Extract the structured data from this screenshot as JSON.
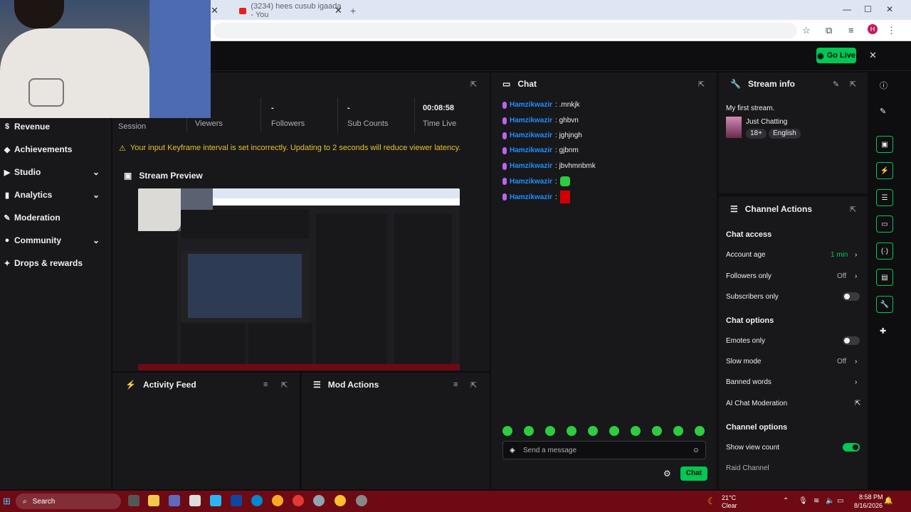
{
  "browser": {
    "tabs": [
      {
        "title": "(3234) hees cusub igaada - You",
        "close": "✕"
      }
    ],
    "new_tab": "+",
    "window_controls": [
      "—",
      "☐",
      "✕"
    ],
    "profile_initial": "H"
  },
  "topbar": {
    "go_live_label": "Go Live",
    "close_icon": "✕"
  },
  "leftnav": {
    "items": [
      {
        "label": "Revenue",
        "icon": "revenue-icon",
        "chevron": false
      },
      {
        "label": "Achievements",
        "icon": "achievements-icon",
        "chevron": false
      },
      {
        "label": "Studio",
        "icon": "studio-icon",
        "chevron": true
      },
      {
        "label": "Analytics",
        "icon": "analytics-icon",
        "chevron": true
      },
      {
        "label": "Moderation",
        "icon": "moderation-icon",
        "chevron": false
      },
      {
        "label": "Community",
        "icon": "community-icon",
        "chevron": true
      },
      {
        "label": "Drops & rewards",
        "icon": "drops-icon",
        "chevron": false
      }
    ]
  },
  "stats": {
    "session_label": "Session",
    "viewers_label": "Viewers",
    "followers_value": "-",
    "followers_label": "Followers",
    "subcounts_value": "-",
    "subcounts_label": "Sub Counts",
    "timelive_value": "00:08:58",
    "timelive_label": "Time Live",
    "warning": "Your input Keyframe interval is set incorrectly. Updating to 2 seconds will reduce viewer latency."
  },
  "preview": {
    "title": "Stream Preview"
  },
  "activity": {
    "title": "Activity Feed"
  },
  "mod": {
    "title": "Mod Actions"
  },
  "chat": {
    "title": "Chat",
    "messages": [
      {
        "user": "Hamzikwazir",
        "text": ": .mnkjk"
      },
      {
        "user": "Hamzikwazir",
        "text": ": ghbvn"
      },
      {
        "user": "Hamzikwazir",
        "text": ": jghjngh"
      },
      {
        "user": "Hamzikwazir",
        "text": ": gjbnm"
      },
      {
        "user": "Hamzikwazir",
        "text": ": jbvhmnbmk"
      },
      {
        "user": "Hamzikwazir",
        "text": ":"
      },
      {
        "user": "Hamzikwazir",
        "text": ":"
      }
    ],
    "input_placeholder": "Send a message",
    "send_label": "Chat"
  },
  "streaminfo": {
    "title": "Stream info",
    "stream_title": "My first stream.",
    "category": "Just Chatting",
    "tags": [
      "18+",
      "English"
    ]
  },
  "channelactions": {
    "title": "Channel Actions",
    "chat_access": "Chat access",
    "account_age": "Account age",
    "account_age_value": "1 min",
    "followers_only": "Followers only",
    "followers_only_value": "Off",
    "subscribers_only": "Subscribers only",
    "chat_options": "Chat options",
    "emotes_only": "Emotes only",
    "slow_mode": "Slow mode",
    "slow_mode_value": "Off",
    "banned_words": "Banned words",
    "ai_moderation": "AI Chat Moderation",
    "channel_options": "Channel options",
    "show_view_count": "Show view count",
    "raid_channel": "Raid Channel"
  },
  "taskbar": {
    "search_label": "Search",
    "weather_temp": "21°C",
    "weather_desc": "Clear",
    "time": "8:58 PM",
    "date": "8/16/2026"
  },
  "colors": {
    "accent": "#00c853",
    "username": "#1e90ff",
    "warning": "#e6c229"
  }
}
